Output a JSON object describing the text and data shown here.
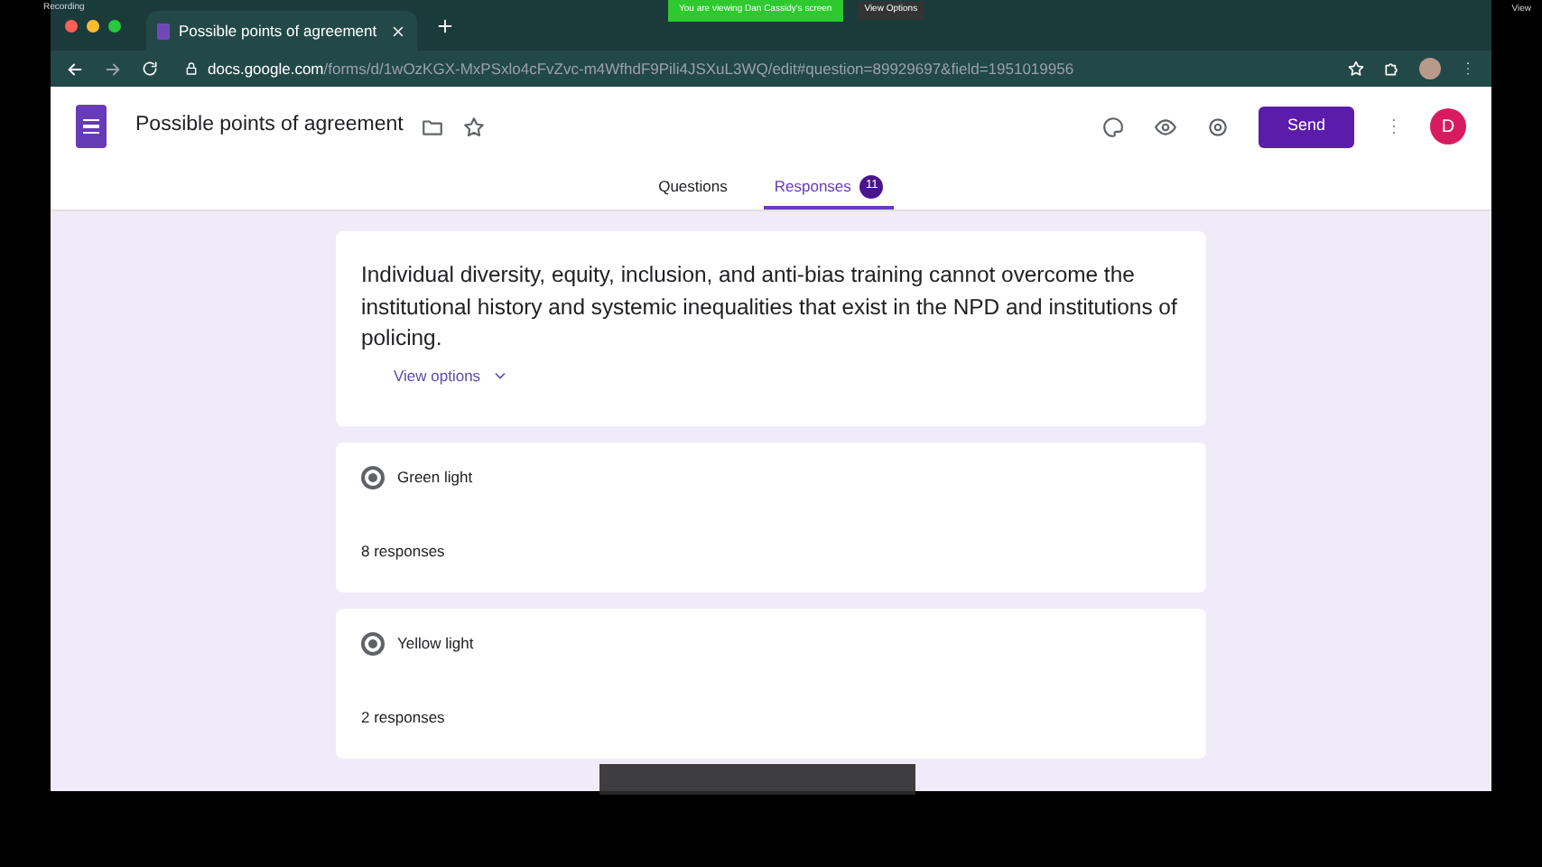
{
  "meeting_bar": {
    "recording": "Recording",
    "banner": "You are viewing Dan Cassidy's screen",
    "view_options": "View Options",
    "view": "View"
  },
  "browser": {
    "tab_title": "Possible points of agreement",
    "url_host": "docs.google.com",
    "url_path": "/forms/d/1wOzKGX-MxPSxlo4cFvZvc-m4WfhdF9Pili4JSXuL3WQ/edit#question=89929697&field=1951019956"
  },
  "form": {
    "title": "Possible points of agreement",
    "send": "Send",
    "avatar": "D",
    "tabs": [
      {
        "label": "Questions",
        "selected": false
      },
      {
        "label": "Responses",
        "selected": true,
        "count": "11"
      }
    ]
  },
  "question": {
    "text": "Individual diversity, equity, inclusion, and anti-bias training cannot overcome the institutional history and systemic inequalities that exist in the NPD and institutions of policing.",
    "view_options": "View options"
  },
  "answers": [
    {
      "label": "Green light",
      "count": "8 responses",
      "checked": true
    },
    {
      "label": "Yellow light",
      "count": "2 responses",
      "checked": true
    }
  ]
}
